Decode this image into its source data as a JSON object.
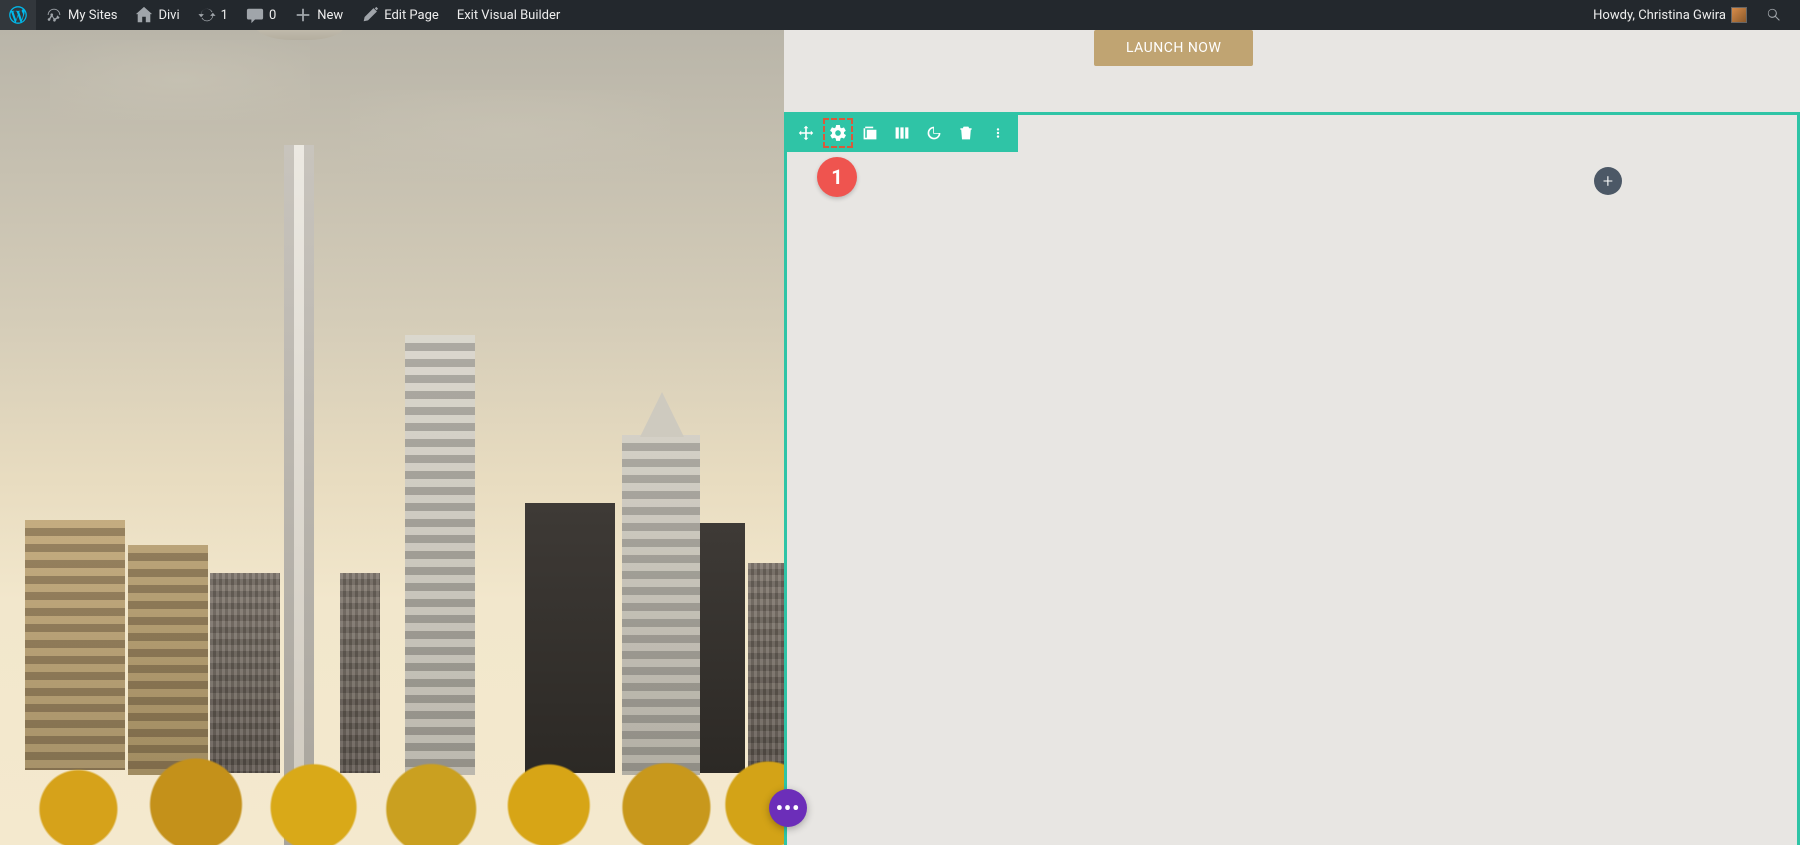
{
  "admin_bar": {
    "my_sites": "My Sites",
    "site_name": "Divi",
    "updates_count": "1",
    "comments_count": "0",
    "new_label": "New",
    "edit_page": "Edit Page",
    "exit_builder": "Exit Visual Builder",
    "greeting": "Howdy, Christina Gwira"
  },
  "cta": {
    "launch": "LAUNCH NOW"
  },
  "annotation": {
    "step": "1"
  },
  "icons": {
    "plus": "+"
  }
}
